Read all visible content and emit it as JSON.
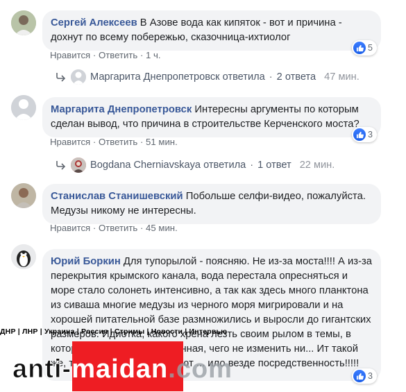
{
  "comments": [
    {
      "author": "Сергей Алексеев",
      "text": "В Азове вода как кипяток - вот и причина - дохнут по всему побережью, сказочница-ихтиолог",
      "like": "Нравится",
      "reply": "Ответить",
      "time": "1 ч.",
      "reactions": "5",
      "replies": {
        "text": "Маргарита Днепропетровск ответила",
        "count": "2 ответа",
        "time": "47 мин."
      }
    },
    {
      "author": "Маргарита Днепропетровск",
      "text": "Интересны аргументы по которым сделан вывод, что причина в строительстве Керченского моста?",
      "like": "Нравится",
      "reply": "Ответить",
      "time": "51 мин.",
      "reactions": "3",
      "replies": {
        "text": "Bogdana Cherniavskaya ответила",
        "count": "1 ответ",
        "time": "22 мин."
      }
    },
    {
      "author": "Станислав Станишевский",
      "text": "Побольше селфи-видео, пожалуйста. Медузы никому не интересны.",
      "like": "Нравится",
      "reply": "Ответить",
      "time": "45 мин."
    },
    {
      "author": "Юрий Боркин",
      "text": "Для тупорылой - поясняю. Не из-за моста!!!! А из-за перекрытия крымского канала, вода перестала опресняться и море стало солонеть интенсивно, а так как здесь много планктона из сиваша многие медузы из черного моря мигрировали и на хорошей питательной базе размножились и выросли до гигантских размеров. Идиотка, какого хрена лезть своим рылом в темы, в которых абсолютно деревянная, чего не изменить ни... Ит такой же, такие люди, которые суют ... ило везде посредственность!!!!!",
      "reactions": "3"
    }
  ],
  "watermark": {
    "bar": "ДНР | ЛНР | Украина | Россия | Стримы | Новости | Интервью",
    "logo_left": "anti-",
    "logo_mid": "maidan",
    "logo_right": ".com"
  }
}
